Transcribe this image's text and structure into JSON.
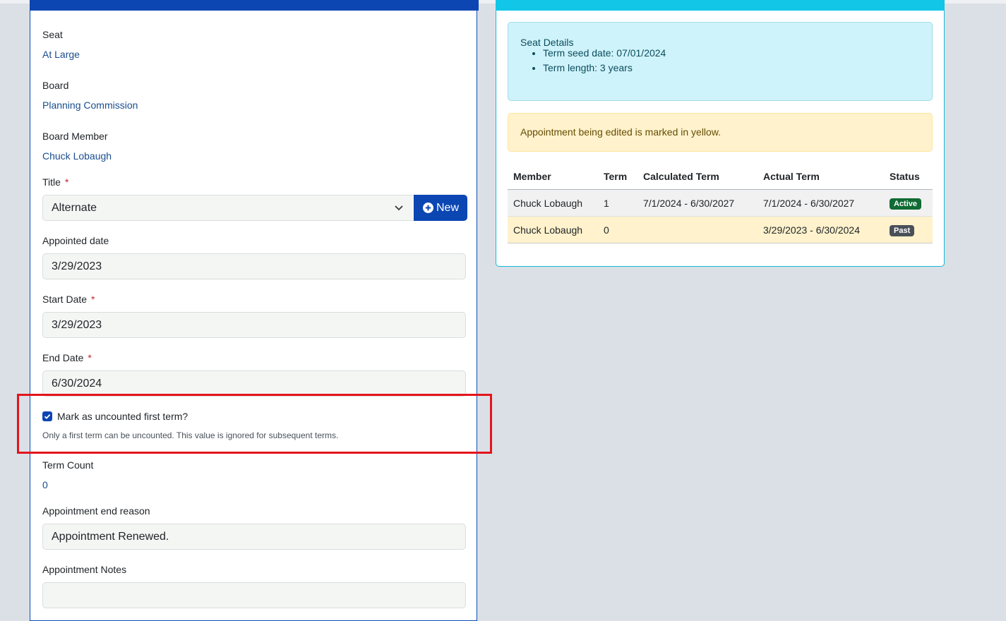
{
  "form": {
    "seat": {
      "label": "Seat",
      "value": "At Large"
    },
    "board": {
      "label": "Board",
      "value": "Planning Commission"
    },
    "member": {
      "label": "Board Member",
      "value": "Chuck Lobaugh"
    },
    "title": {
      "label": "Title",
      "required_mark": "*",
      "value": "Alternate",
      "new_button": "New"
    },
    "appointed_date": {
      "label": "Appointed date",
      "value": "3/29/2023"
    },
    "start_date": {
      "label": "Start Date",
      "required_mark": "*",
      "value": "3/29/2023"
    },
    "end_date": {
      "label": "End Date",
      "required_mark": "*",
      "value": "6/30/2024"
    },
    "uncounted": {
      "label": "Mark as uncounted first term?",
      "checked": true,
      "help": "Only a first term can be uncounted. This value is ignored for subsequent terms."
    },
    "term_count": {
      "label": "Term Count",
      "value": "0"
    },
    "end_reason": {
      "label": "Appointment end reason",
      "value": "Appointment Renewed."
    },
    "notes": {
      "label": "Appointment Notes",
      "value": ""
    }
  },
  "side": {
    "seat_details": {
      "title": "Seat Details",
      "items": [
        "Term seed date: 07/01/2024",
        "Term length: 3 years"
      ]
    },
    "warning": "Appointment being edited is marked in yellow.",
    "table": {
      "headers": [
        "Member",
        "Term",
        "Calculated Term",
        "Actual Term",
        "Status"
      ],
      "rows": [
        {
          "member": "Chuck Lobaugh",
          "term": "1",
          "calculated": "7/1/2024 - 6/30/2027",
          "actual": "7/1/2024 - 6/30/2027",
          "status": "Active"
        },
        {
          "member": "Chuck Lobaugh",
          "term": "0",
          "calculated": "",
          "actual": "3/29/2023 - 6/30/2024",
          "status": "Past"
        }
      ]
    }
  },
  "colors": {
    "primary": "#0b46b3",
    "info": "#11c6e6",
    "highlight": "#e3151b",
    "active_badge": "#116b34",
    "past_badge": "#4a5058"
  }
}
